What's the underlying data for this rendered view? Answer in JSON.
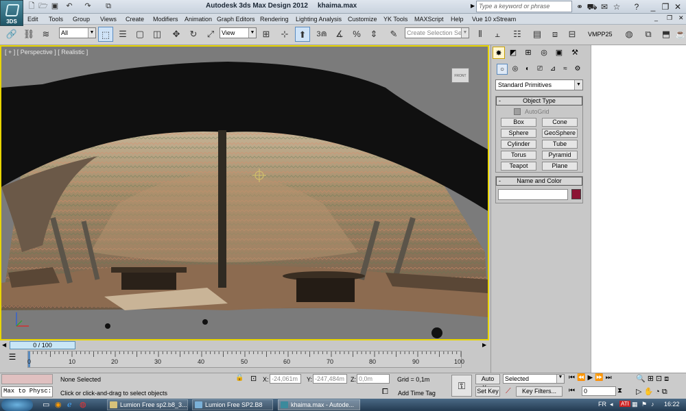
{
  "title_bar": {
    "app_logo_text": "3DS",
    "app_title": "Autodesk 3ds Max Design 2012",
    "file_name": "khaima.max",
    "search_placeholder": "Type a keyword or phrase",
    "window_min": "_",
    "window_restore": "❐",
    "window_close": "✕"
  },
  "menu": [
    "Edit",
    "Tools",
    "Group",
    "Views",
    "Create",
    "Modifiers",
    "Animation",
    "Graph Editors",
    "Rendering",
    "Lighting Analysis",
    "Customize",
    "YK Tools",
    "MAXScript",
    "Help",
    "Vue 10 xStream"
  ],
  "menu_controls": {
    "min": "_",
    "restore": "❐",
    "close": "✕"
  },
  "toolbar": {
    "filter_value": "All",
    "ref_coord_value": "View",
    "selection_set_placeholder": "Create Selection Se",
    "plugin_label": "VMPP25",
    "snap_label": "3"
  },
  "viewport": {
    "label": "[ + ] [ Perspective ] [ Realistic ]",
    "viewcube_label": "FRONT",
    "time_slider": "0 / 100"
  },
  "timeline": {
    "ticks": [
      "0",
      "10",
      "20",
      "30",
      "40",
      "50",
      "60",
      "70",
      "80",
      "90",
      "100"
    ]
  },
  "command_panel": {
    "dropdown_value": "Standard Primitives",
    "object_type_title": "Object Type",
    "autogrid_label": "AutoGrid",
    "buttons": [
      "Box",
      "Cone",
      "Sphere",
      "GeoSphere",
      "Cylinder",
      "Tube",
      "Torus",
      "Pyramid",
      "Teapot",
      "Plane"
    ],
    "name_color_title": "Name and Color",
    "name_value": "",
    "object_color": "#8c1434",
    "rollout_minus": "-"
  },
  "status": {
    "maxscript_text": "Max to Physc:",
    "selection_text": "None Selected",
    "prompt_text": "Click or click-and-drag to select objects",
    "x_label": "X:",
    "x_value": "-24,061m",
    "y_label": "Y:",
    "y_value": "-247,484m",
    "z_label": "Z:",
    "z_value": "0,0m",
    "grid_text": "Grid = 0,1m",
    "add_time_tag": "Add Time Tag",
    "auto_key": "Auto Key",
    "set_key": "Set Key",
    "key_mode_value": "Selected",
    "key_filters": "Key Filters...",
    "frame_value": "0"
  },
  "taskbar": {
    "tasks": [
      "Lumion Free sp2.b8_3....",
      "Lumion Free SP2.B8",
      "khaima.max - Autode..."
    ],
    "language": "FR",
    "clock": "16:22"
  },
  "colors": {
    "viewport_border": "#e8d500",
    "accent": "#5a8bbf"
  }
}
